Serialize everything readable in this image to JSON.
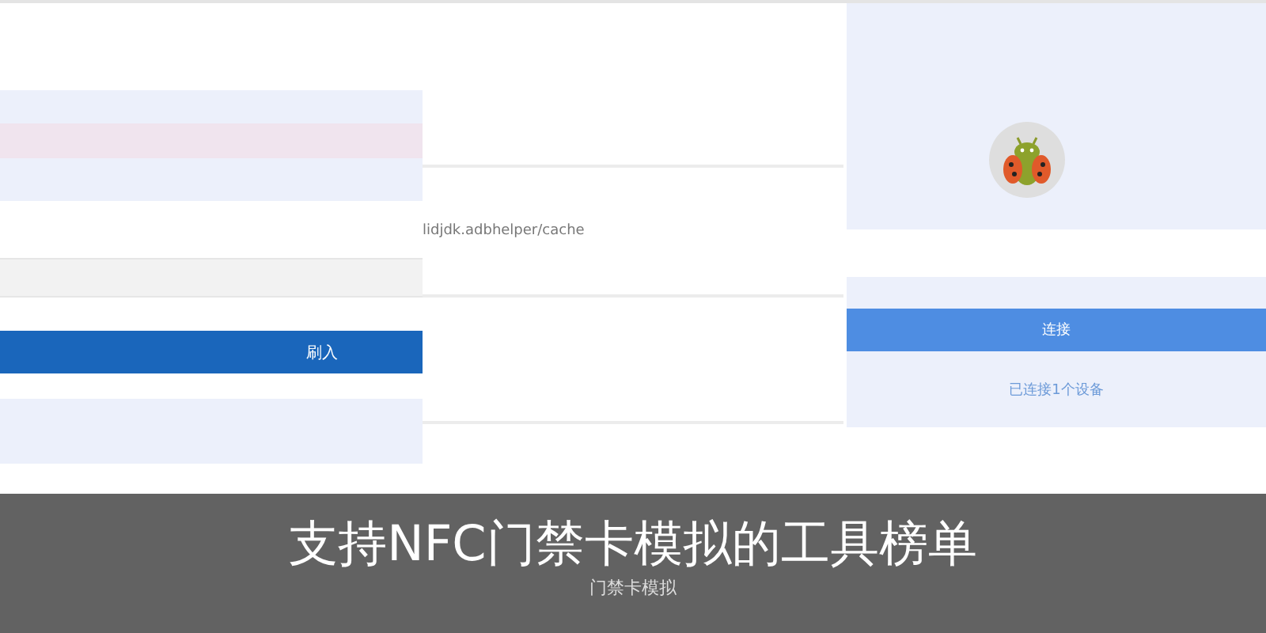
{
  "flash_panel": {
    "flash_button": "刷入"
  },
  "path_panel": {
    "path": "lidjdk.adbhelper/cache"
  },
  "device_panel": {
    "connect_button": "连接",
    "status": "已连接1个设备"
  },
  "caption": {
    "title": "支持NFC门禁卡模拟的工具榜单",
    "subtitle": "门禁卡模拟"
  }
}
